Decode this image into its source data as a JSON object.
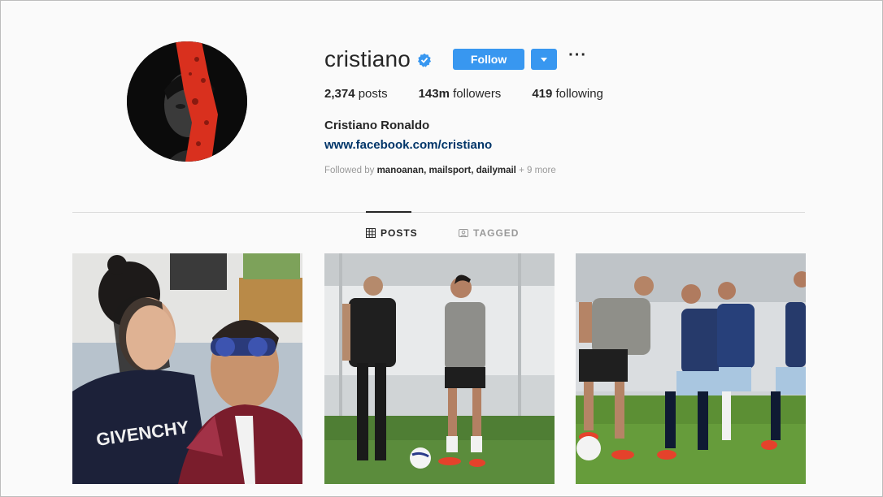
{
  "profile": {
    "username": "cristiano",
    "verified_icon": "verified-badge-icon",
    "follow_label": "Follow",
    "more_label": "···",
    "full_name": "Cristiano Ronaldo",
    "website": "www.facebook.com/cristiano",
    "stats": {
      "posts_value": "2,374",
      "posts_label": "posts",
      "followers_value": "143m",
      "followers_label": "followers",
      "following_value": "419",
      "following_label": "following"
    },
    "followed_by": {
      "prefix": "Followed by",
      "names": "manoanan, mailsport, dailymail",
      "more": "+ 9 more"
    }
  },
  "tabs": [
    {
      "label": "POSTS",
      "icon": "grid-icon",
      "active": true
    },
    {
      "label": "TAGGED",
      "icon": "tagged-icon",
      "active": false
    }
  ],
  "posts": [
    {
      "kind": "selfie photo",
      "shirt_text": "GIVENCHY"
    },
    {
      "kind": "training pitch photo"
    },
    {
      "kind": "match play photo"
    }
  ],
  "colors": {
    "accent": "#3897f0",
    "link": "#003569",
    "muted": "#999999",
    "avatar_red": "#d9301e"
  }
}
